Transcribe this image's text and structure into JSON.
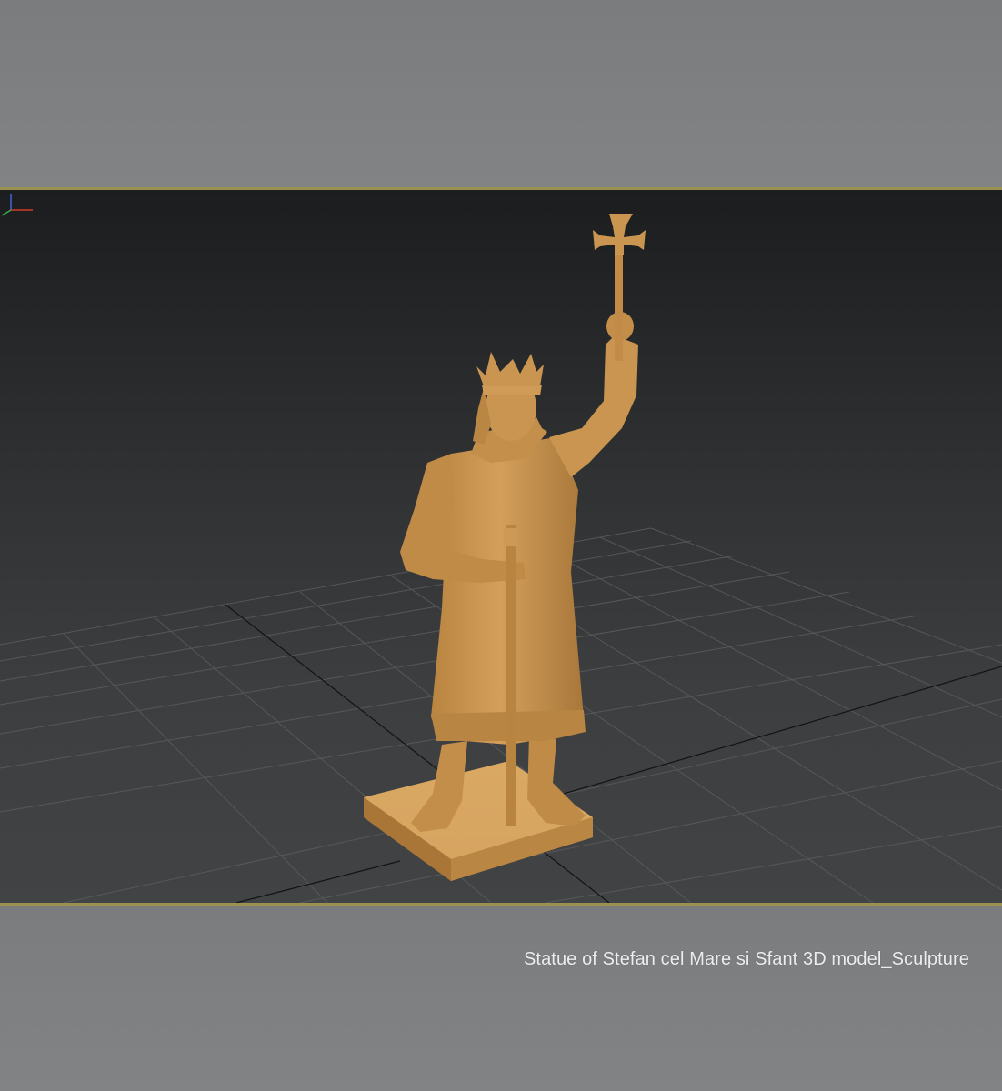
{
  "viewport": {
    "statue_color": "#c99550",
    "statue_shade": "#9c6e34",
    "grid_color": "#5b5d5f",
    "axis_color": "#111214",
    "frame_color": "#9a9152"
  },
  "gizmo": {
    "icon": "axis-tripod-icon",
    "x_color": "#d23b2b",
    "y_color": "#3aa94a",
    "z_color": "#4460d8"
  },
  "caption": {
    "text": "Statue of Stefan cel Mare si Sfant 3D model_Sculpture"
  }
}
